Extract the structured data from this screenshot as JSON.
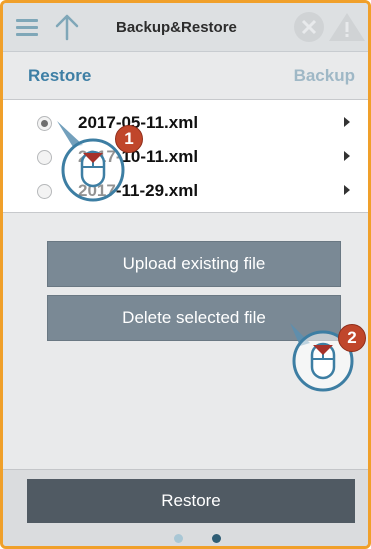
{
  "header": {
    "title": "Backup&Restore",
    "menu_icon": "hamburger-menu-icon",
    "up_icon": "arrow-up-icon",
    "status_icons": [
      "close-circle-icon",
      "warning-icon"
    ]
  },
  "tabs": {
    "restore_label": "Restore",
    "backup_label": "Backup",
    "active": "Restore"
  },
  "files": [
    {
      "name": "2017-05-11.xml",
      "selected": true
    },
    {
      "name": "2017-10-11.xml",
      "selected": false
    },
    {
      "name": "2017-11-29.xml",
      "selected": false
    }
  ],
  "actions": {
    "upload_label": "Upload existing file",
    "delete_label": "Delete selected file"
  },
  "footer": {
    "restore_label": "Restore",
    "pages": 2,
    "current_page": 2
  },
  "callouts": [
    {
      "number": "1"
    },
    {
      "number": "2"
    }
  ],
  "colors": {
    "frame_border": "#f0a02a",
    "tab_active": "#3e7fa5",
    "tab_inactive": "#9fb8c6",
    "button": "#7a8995",
    "restore_button": "#505a63",
    "callout_badge": "#c0462b"
  }
}
